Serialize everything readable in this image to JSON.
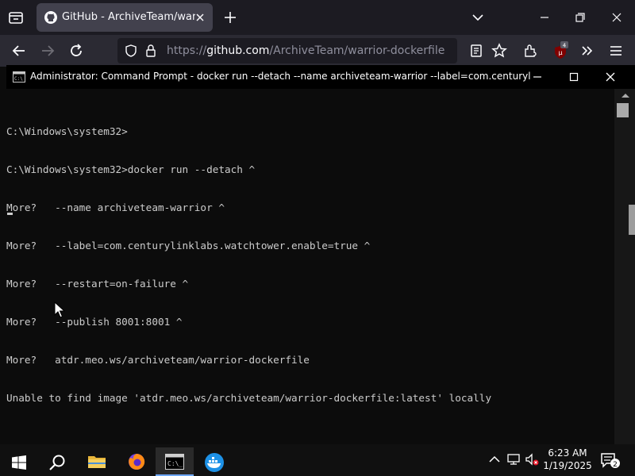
{
  "browser": {
    "tab": {
      "title": "GitHub - ArchiveTeam/warrior-dockerfile",
      "favicon": "github-icon"
    },
    "url": {
      "scheme": "https://",
      "host": "github.com",
      "path": "/ArchiveTeam/warrior-dockerfile"
    },
    "extension_badge": "4"
  },
  "cmd": {
    "title": "Administrator: Command Prompt - docker  run --detach   --name archiveteam-warrior   --label=com.centurylinklabs.watchtower.enable=true   --restart=on-failure   --publish 8001:8001   atdr.meo.ws/archiveteam/warrior-dockerfile",
    "lines": [
      "C:\\Windows\\system32>",
      "C:\\Windows\\system32>docker run --detach ^",
      "More?   --name archiveteam-warrior ^",
      "More?   --label=com.centurylinklabs.watchtower.enable=true ^",
      "More?   --restart=on-failure ^",
      "More?   --publish 8001:8001 ^",
      "More?   atdr.meo.ws/archiveteam/warrior-dockerfile",
      "Unable to find image 'atdr.meo.ws/archiveteam/warrior-dockerfile:latest' locally"
    ]
  },
  "taskbar": {
    "time": "6:23 AM",
    "date": "1/19/2025",
    "notification_count": "2",
    "pinned": [
      "start-button",
      "search-button",
      "file-explorer",
      "firefox",
      "command-prompt",
      "docker-desktop"
    ]
  },
  "colors": {
    "accent": "#6ea8ff",
    "console_bg": "#0c0c0c",
    "console_fg": "#cccccc",
    "tab_bg": "#42414d"
  }
}
